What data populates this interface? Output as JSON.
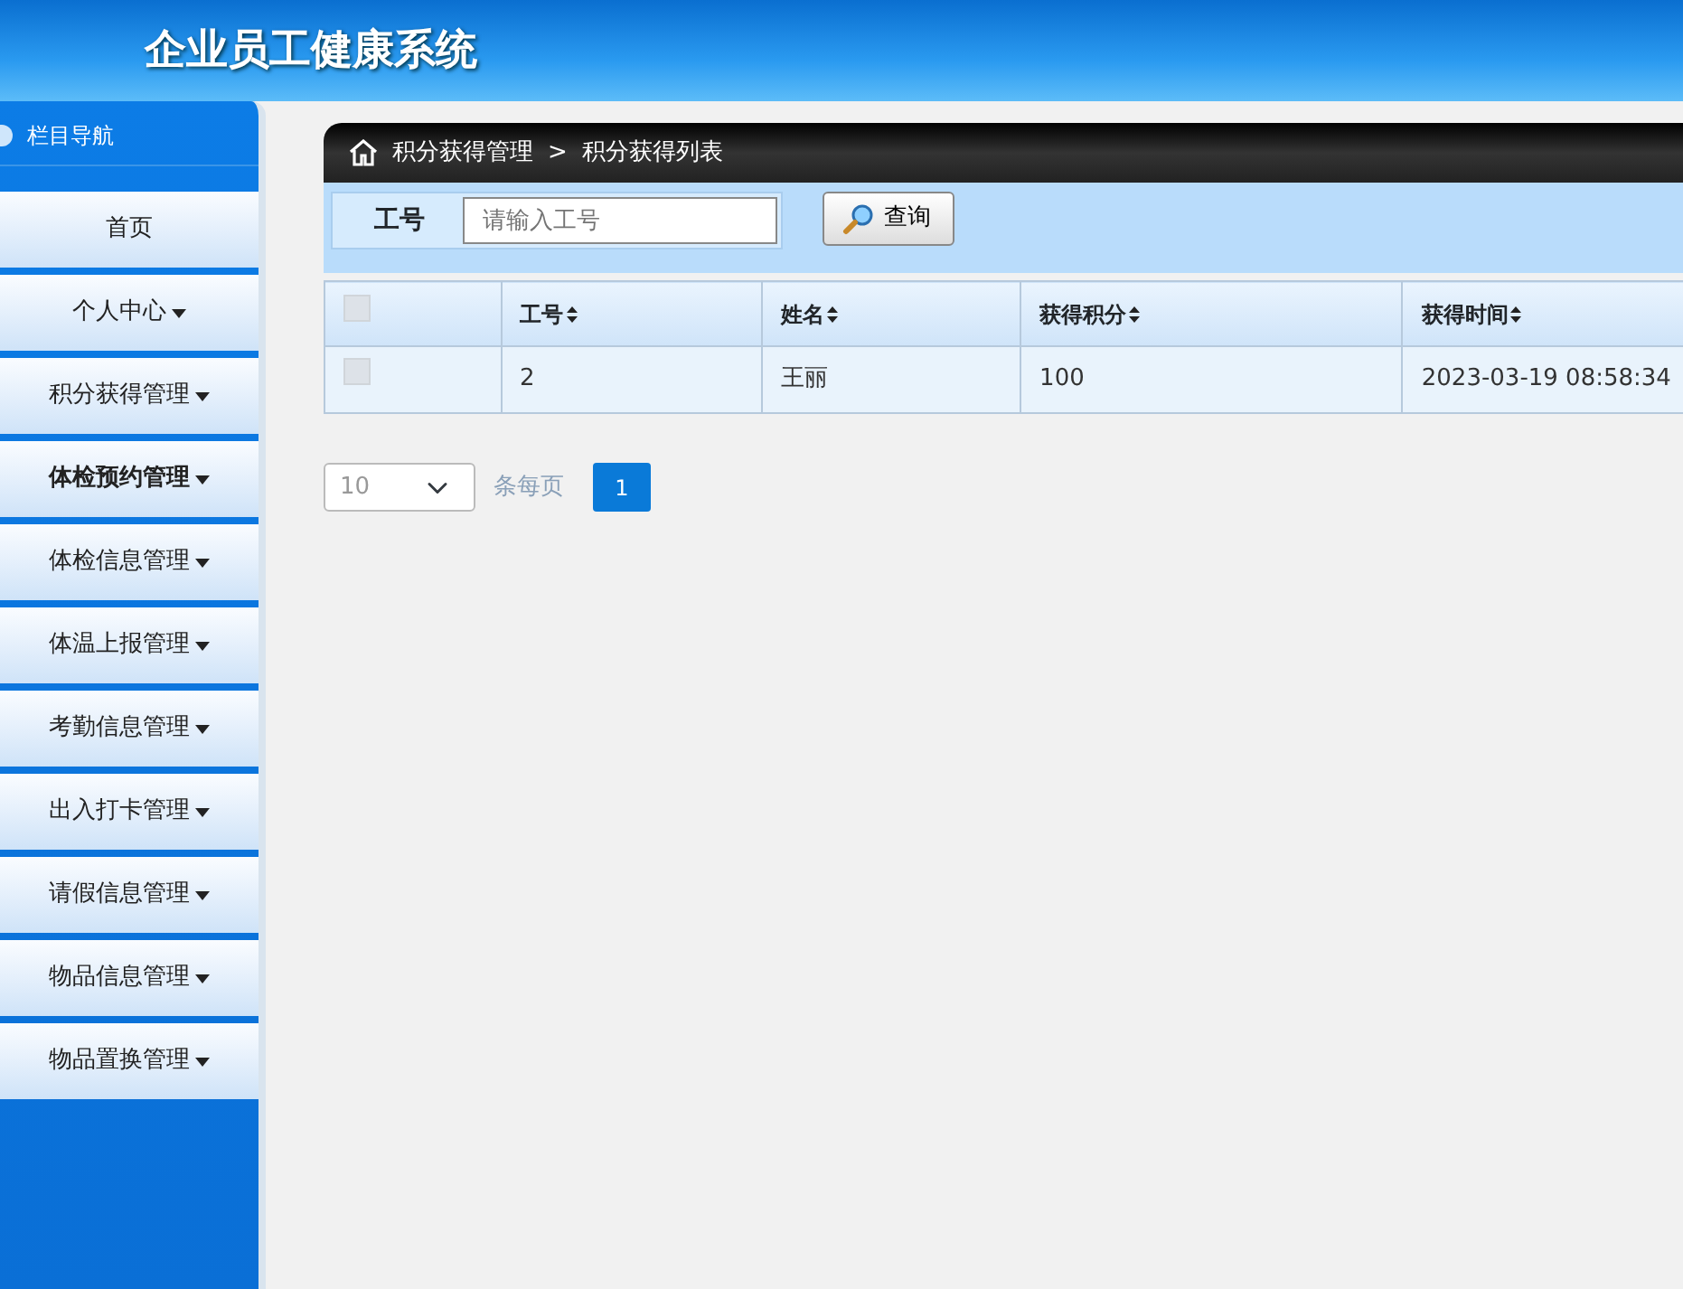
{
  "header": {
    "title": "企业员工健康系统"
  },
  "sidebar": {
    "title": "栏目导航",
    "items": [
      {
        "label": "首页",
        "has_menu": false,
        "hovered": false
      },
      {
        "label": "个人中心",
        "has_menu": true,
        "hovered": false
      },
      {
        "label": "积分获得管理",
        "has_menu": true,
        "hovered": false
      },
      {
        "label": "体检预约管理",
        "has_menu": true,
        "hovered": true
      },
      {
        "label": "体检信息管理",
        "has_menu": true,
        "hovered": false
      },
      {
        "label": "体温上报管理",
        "has_menu": true,
        "hovered": false
      },
      {
        "label": "考勤信息管理",
        "has_menu": true,
        "hovered": false
      },
      {
        "label": "出入打卡管理",
        "has_menu": true,
        "hovered": false
      },
      {
        "label": "请假信息管理",
        "has_menu": true,
        "hovered": false
      },
      {
        "label": "物品信息管理",
        "has_menu": true,
        "hovered": false
      },
      {
        "label": "物品置换管理",
        "has_menu": true,
        "hovered": false
      }
    ]
  },
  "breadcrumb": {
    "parent": "积分获得管理",
    "separator": ">",
    "current": "积分获得列表"
  },
  "search": {
    "label": "工号",
    "placeholder": "请输入工号",
    "button": "查询"
  },
  "table": {
    "select_all_checked": false,
    "columns": [
      "工号",
      "姓名",
      "获得积分",
      "获得时间"
    ],
    "rows": [
      {
        "checked": false,
        "cells": [
          "2",
          "王丽",
          "100",
          "2023-03-19 08:58:34"
        ]
      }
    ]
  },
  "pagination": {
    "page_size": "10",
    "per_page_label": "条每页",
    "pages": [
      {
        "label": "1",
        "selected": true
      }
    ]
  }
}
